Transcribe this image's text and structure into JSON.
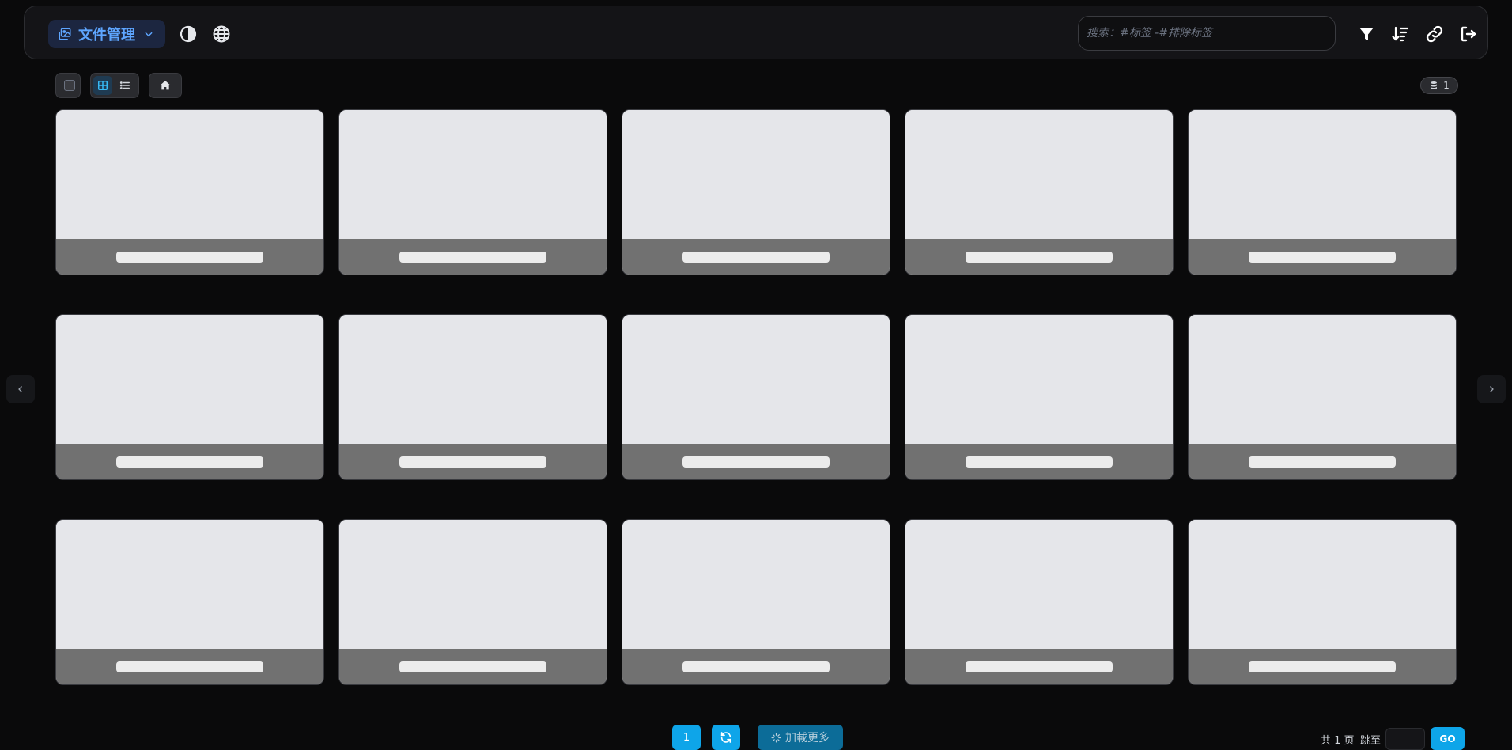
{
  "header": {
    "menu_label": "文件管理",
    "search_placeholder": "搜索：#标签 -#排除标签",
    "search_value": ""
  },
  "toolbar": {
    "view_mode": "grid",
    "item_count": "1"
  },
  "grid": {
    "card_count": 15
  },
  "pagination": {
    "current_page": "1",
    "load_more_label": "加載更多",
    "total_pages_label": "共 1 页",
    "jump_label": "跳至",
    "jump_value": "",
    "go_label": "GO"
  },
  "colors": {
    "accent": "#0ea5e9",
    "menu_text": "#5ea6ff",
    "card_thumb": "#e5e6ea",
    "card_footer": "#717171"
  },
  "icons": {
    "menu": "image-icon",
    "theme": "contrast-icon",
    "language": "globe-icon",
    "filter": "filter-icon",
    "sort": "sort-icon",
    "link": "link-icon",
    "logout": "logout-icon",
    "home": "home-icon",
    "grid_view": "grid-icon",
    "list_view": "list-icon",
    "count": "database-icon",
    "refresh": "refresh-icon",
    "prev": "chevron-left-icon",
    "next": "chevron-right-icon"
  }
}
